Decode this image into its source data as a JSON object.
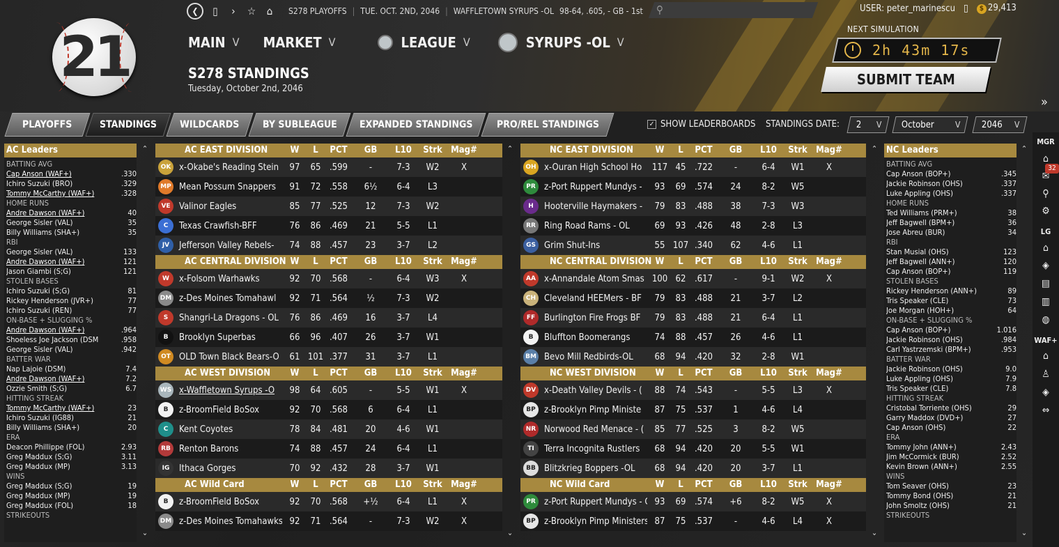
{
  "header": {
    "logo_text": "21",
    "nav_info": [
      "S278 PLAYOFFS",
      "TUE. OCT. 2ND, 2046",
      "WAFFLETOWN SYRUPS -OL",
      "98-64, .605, - GB - 1st"
    ],
    "user": "USER: peter_marinescu",
    "coins": "29,413",
    "next_sim_label": "NEXT SIMULATION",
    "timer": "2h 43m 17s",
    "submit": "SUBMIT TEAM"
  },
  "menus": [
    "MAIN",
    "MARKET",
    "LEAGUE",
    "SYRUPS -OL"
  ],
  "page": {
    "title": "S278 STANDINGS",
    "subtitle": "Tuesday, October 2nd, 2046"
  },
  "tabs": [
    "PLAYOFFS",
    "STANDINGS",
    "WILDCARDS",
    "BY SUBLEAGUE",
    "EXPANDED STANDINGS",
    "PRO/REL STANDINGS"
  ],
  "controls": {
    "show_leaderboards": "SHOW LEADERBOARDS",
    "standings_date": "STANDINGS DATE:",
    "day": "2",
    "month": "October",
    "year": "2046"
  },
  "columns": [
    "W",
    "L",
    "PCT",
    "GB",
    "L10",
    "Strk",
    "Mag#"
  ],
  "ac_leaders": {
    "title": "AC Leaders",
    "cats": [
      {
        "name": "BATTING AVG",
        "rows": [
          [
            "Cap Anson (WAF+)",
            ".330",
            true
          ],
          [
            "Ichiro Suzuki (BRO)",
            ".329",
            false
          ],
          [
            "Tommy McCarthy (WAF+)",
            ".328",
            true
          ]
        ]
      },
      {
        "name": "HOME RUNS",
        "rows": [
          [
            "Andre Dawson (WAF+)",
            "40",
            true
          ],
          [
            "George Sisler (VAL)",
            "35",
            false
          ],
          [
            "Billy Williams (SHA+)",
            "35",
            false
          ]
        ]
      },
      {
        "name": "RBI",
        "rows": [
          [
            "George Sisler (VAL)",
            "133",
            false
          ],
          [
            "Andre Dawson (WAF+)",
            "121",
            true
          ],
          [
            "Jason Giambi (S;G)",
            "121",
            false
          ]
        ]
      },
      {
        "name": "STOLEN BASES",
        "rows": [
          [
            "Ichiro Suzuki (S;G)",
            "81",
            false
          ],
          [
            "Rickey Henderson (JVR+)",
            "77",
            false
          ],
          [
            "Ichiro Suzuki (REN)",
            "77",
            false
          ]
        ]
      },
      {
        "name": "ON-BASE + SLUGGING %",
        "rows": [
          [
            "Andre Dawson (WAF+)",
            ".964",
            true
          ],
          [
            "Shoeless Joe Jackson (DSM",
            ".958",
            false
          ],
          [
            "George Sisler (VAL)",
            ".942",
            false
          ]
        ]
      },
      {
        "name": "BATTER WAR",
        "rows": [
          [
            "Nap Lajoie (DSM)",
            "7.4",
            false
          ],
          [
            "Andre Dawson (WAF+)",
            "7.2",
            true
          ],
          [
            "Ozzie Smith (S;G)",
            "6.7",
            false
          ]
        ]
      },
      {
        "name": "HITTING STREAK",
        "rows": [
          [
            "Tommy McCarthy (WAF+)",
            "23",
            true
          ],
          [
            "Ichiro Suzuki (IG88)",
            "21",
            false
          ],
          [
            "Billy Williams (SHA+)",
            "20",
            false
          ]
        ]
      },
      {
        "name": "ERA",
        "rows": [
          [
            "Deacon Phillippe (FOL)",
            "2.93",
            false
          ],
          [
            "Greg Maddux (S;G)",
            "3.11",
            false
          ],
          [
            "Greg Maddux (MP)",
            "3.13",
            false
          ]
        ]
      },
      {
        "name": "WINS",
        "rows": [
          [
            "Greg Maddux (S;G)",
            "19",
            false
          ],
          [
            "Greg Maddux (MP)",
            "19",
            false
          ],
          [
            "Greg Maddux (FOL)",
            "18",
            false
          ]
        ]
      },
      {
        "name": "STRIKEOUTS",
        "rows": []
      }
    ]
  },
  "nc_leaders": {
    "title": "NC Leaders",
    "cats": [
      {
        "name": "BATTING AVG",
        "rows": [
          [
            "Cap Anson (BOP+)",
            ".345",
            false
          ],
          [
            "Jackie Robinson (OHS)",
            ".337",
            false
          ],
          [
            "Luke Appling (OHS)",
            ".337",
            false
          ]
        ]
      },
      {
        "name": "HOME RUNS",
        "rows": [
          [
            "Ted Williams (PRM+)",
            "38",
            false
          ],
          [
            "Jeff Bagwell (BPM+)",
            "36",
            false
          ],
          [
            "Jose Abreu (BUR)",
            "34",
            false
          ]
        ]
      },
      {
        "name": "RBI",
        "rows": [
          [
            "Stan Musial (OHS)",
            "123",
            false
          ],
          [
            "Jeff Bagwell (ANN+)",
            "120",
            false
          ],
          [
            "Cap Anson (BOP+)",
            "119",
            false
          ]
        ]
      },
      {
        "name": "STOLEN BASES",
        "rows": [
          [
            "Rickey Henderson (ANN+)",
            "89",
            false
          ],
          [
            "Tris Speaker (CLE)",
            "73",
            false
          ],
          [
            "Joe Morgan (HOH+)",
            "64",
            false
          ]
        ]
      },
      {
        "name": "ON-BASE + SLUGGING %",
        "rows": [
          [
            "Cap Anson (BOP+)",
            "1.016",
            false
          ],
          [
            "Jackie Robinson (OHS)",
            ".984",
            false
          ],
          [
            "Carl Yastrzemski (BPM+)",
            ".953",
            false
          ]
        ]
      },
      {
        "name": "BATTER WAR",
        "rows": [
          [
            "Jackie Robinson (OHS)",
            "9.0",
            false
          ],
          [
            "Luke Appling (OHS)",
            "7.9",
            false
          ],
          [
            "Tris Speaker (CLE)",
            "7.8",
            false
          ]
        ]
      },
      {
        "name": "HITTING STREAK",
        "rows": [
          [
            "Cristobal Torriente (OHS)",
            "29",
            false
          ],
          [
            "Garry Maddox (DVD+)",
            "27",
            false
          ],
          [
            "Cap Anson (OHS)",
            "22",
            false
          ]
        ]
      },
      {
        "name": "ERA",
        "rows": [
          [
            "Tommy John (ANN+)",
            "2.43",
            false
          ],
          [
            "Jim McCormick (BUR)",
            "2.52",
            false
          ],
          [
            "Kevin Brown (ANN+)",
            "2.55",
            false
          ]
        ]
      },
      {
        "name": "WINS",
        "rows": [
          [
            "Tom Seaver (OHS)",
            "23",
            false
          ],
          [
            "Tommy Bond (OHS)",
            "21",
            false
          ],
          [
            "John Smoltz (OHS)",
            "21",
            false
          ]
        ]
      },
      {
        "name": "STRIKEOUTS",
        "rows": []
      }
    ]
  },
  "ac_divisions": [
    {
      "name": "AC EAST DIVISION",
      "teams": [
        {
          "name": "x-Okabe's Reading Stein",
          "w": "97",
          "l": "65",
          "pct": ".599",
          "gb": "-",
          "l10": "7-3",
          "strk": "W2",
          "mag": "X",
          "logo": "#c9a23a",
          "abbr": "OK"
        },
        {
          "name": "Mean Possum Snappers",
          "w": "91",
          "l": "72",
          "pct": ".558",
          "gb": "6½",
          "l10": "6-4",
          "strk": "L3",
          "mag": "",
          "logo": "#e07a2a",
          "abbr": "MP"
        },
        {
          "name": "Valinor Eagles",
          "w": "85",
          "l": "77",
          "pct": ".525",
          "gb": "12",
          "l10": "7-3",
          "strk": "W2",
          "mag": "",
          "logo": "#c0392b",
          "abbr": "VE"
        },
        {
          "name": "Texas Crawfish-BFF",
          "w": "76",
          "l": "86",
          "pct": ".469",
          "gb": "21",
          "l10": "5-5",
          "strk": "L1",
          "mag": "",
          "logo": "#3b6fd4",
          "abbr": "C"
        },
        {
          "name": "Jefferson Valley Rebels-",
          "w": "74",
          "l": "88",
          "pct": ".457",
          "gb": "23",
          "l10": "3-7",
          "strk": "L2",
          "mag": "",
          "logo": "#2f5fa8",
          "abbr": "JV"
        }
      ]
    },
    {
      "name": "AC CENTRAL DIVISION",
      "teams": [
        {
          "name": "x-Folsom Warhawks",
          "w": "92",
          "l": "70",
          "pct": ".568",
          "gb": "-",
          "l10": "6-4",
          "strk": "W3",
          "mag": "X",
          "logo": "#c0392b",
          "abbr": "W"
        },
        {
          "name": "z-Des Moines Tomahawl",
          "w": "92",
          "l": "71",
          "pct": ".564",
          "gb": "½",
          "l10": "7-3",
          "strk": "W2",
          "mag": "",
          "logo": "#8a8a8a",
          "abbr": "DM"
        },
        {
          "name": "Shangri-La Dragons - OL",
          "w": "76",
          "l": "86",
          "pct": ".469",
          "gb": "16",
          "l10": "3-7",
          "strk": "L4",
          "mag": "",
          "logo": "#c0392b",
          "abbr": "S"
        },
        {
          "name": "Brooklyn Superbas",
          "w": "66",
          "l": "96",
          "pct": ".407",
          "gb": "26",
          "l10": "3-7",
          "strk": "W1",
          "mag": "",
          "logo": "#111111",
          "abbr": "B"
        },
        {
          "name": "OLD Town Black Bears-O",
          "w": "61",
          "l": "101",
          "pct": ".377",
          "gb": "31",
          "l10": "3-7",
          "strk": "L1",
          "mag": "",
          "logo": "#d08a22",
          "abbr": "OT"
        }
      ]
    },
    {
      "name": "AC WEST DIVISION",
      "teams": [
        {
          "name": "x-Waffletown Syrups -O",
          "w": "98",
          "l": "64",
          "pct": ".605",
          "gb": "-",
          "l10": "5-5",
          "strk": "W1",
          "mag": "X",
          "logo": "#a9b6bc",
          "abbr": "WS",
          "u": true
        },
        {
          "name": "z-BroomField BoSox",
          "w": "92",
          "l": "70",
          "pct": ".568",
          "gb": "6",
          "l10": "6-4",
          "strk": "L1",
          "mag": "",
          "logo": "#f2f2f2",
          "abbr": "B"
        },
        {
          "name": "Kent Coyotes",
          "w": "78",
          "l": "84",
          "pct": ".481",
          "gb": "20",
          "l10": "4-6",
          "strk": "W1",
          "mag": "",
          "logo": "#1f8f8a",
          "abbr": "C"
        },
        {
          "name": "Renton Barons",
          "w": "74",
          "l": "88",
          "pct": ".457",
          "gb": "24",
          "l10": "6-4",
          "strk": "L1",
          "mag": "",
          "logo": "#b33a3a",
          "abbr": "RB"
        },
        {
          "name": "Ithaca Gorges",
          "w": "70",
          "l": "92",
          "pct": ".432",
          "gb": "28",
          "l10": "3-7",
          "strk": "W1",
          "mag": "",
          "logo": "#333333",
          "abbr": "IG"
        }
      ]
    },
    {
      "name": "AC  Wild Card",
      "teams": [
        {
          "name": "z-BroomField BoSox",
          "w": "92",
          "l": "70",
          "pct": ".568",
          "gb": "+½",
          "l10": "6-4",
          "strk": "L1",
          "mag": "X",
          "logo": "#f2f2f2",
          "abbr": "B"
        },
        {
          "name": "z-Des Moines Tomahawks",
          "w": "92",
          "l": "71",
          "pct": ".564",
          "gb": "-",
          "l10": "7-3",
          "strk": "W2",
          "mag": "X",
          "logo": "#8a8a8a",
          "abbr": "DM"
        }
      ]
    }
  ],
  "nc_divisions": [
    {
      "name": "NC EAST DIVISION",
      "teams": [
        {
          "name": "x-Ouran High School Ho",
          "w": "117",
          "l": "45",
          "pct": ".722",
          "gb": "-",
          "l10": "6-4",
          "strk": "W1",
          "mag": "X",
          "logo": "#d9a521",
          "abbr": "OH"
        },
        {
          "name": "z-Port Ruppert Mundys -",
          "w": "93",
          "l": "69",
          "pct": ".574",
          "gb": "24",
          "l10": "8-2",
          "strk": "W5",
          "mag": "",
          "logo": "#2e8b3c",
          "abbr": "PR"
        },
        {
          "name": "Hooterville Haymakers -",
          "w": "79",
          "l": "83",
          "pct": ".488",
          "gb": "38",
          "l10": "7-3",
          "strk": "W3",
          "mag": "",
          "logo": "#6a2b8c",
          "abbr": "H"
        },
        {
          "name": "Ring Road Rams - OL",
          "w": "69",
          "l": "93",
          "pct": ".426",
          "gb": "48",
          "l10": "2-8",
          "strk": "L3",
          "mag": "",
          "logo": "#777777",
          "abbr": "RR"
        },
        {
          "name": "Grim Shut-Ins",
          "w": "55",
          "l": "107",
          "pct": ".340",
          "gb": "62",
          "l10": "4-6",
          "strk": "L1",
          "mag": "",
          "logo": "#3b5fa0",
          "abbr": "GS"
        }
      ]
    },
    {
      "name": "NC CENTRAL DIVISION",
      "teams": [
        {
          "name": "x-Annandale Atom Smas",
          "w": "100",
          "l": "62",
          "pct": ".617",
          "gb": "-",
          "l10": "9-1",
          "strk": "W2",
          "mag": "X",
          "logo": "#c0392b",
          "abbr": "AA"
        },
        {
          "name": "Cleveland HEEMers - BF",
          "w": "79",
          "l": "83",
          "pct": ".488",
          "gb": "21",
          "l10": "3-7",
          "strk": "L2",
          "mag": "",
          "logo": "#c9b27a",
          "abbr": "CH"
        },
        {
          "name": "Burlington Fire Frogs BF",
          "w": "79",
          "l": "83",
          "pct": ".488",
          "gb": "21",
          "l10": "6-4",
          "strk": "L1",
          "mag": "",
          "logo": "#b02a2a",
          "abbr": "FF"
        },
        {
          "name": "Bluffton Boomerangs",
          "w": "74",
          "l": "88",
          "pct": ".457",
          "gb": "26",
          "l10": "4-6",
          "strk": "L1",
          "mag": "",
          "logo": "#f2f2f2",
          "abbr": "B"
        },
        {
          "name": "Bevo Mill Redbirds-OL",
          "w": "68",
          "l": "94",
          "pct": ".420",
          "gb": "32",
          "l10": "2-8",
          "strk": "W1",
          "mag": "",
          "logo": "#5a7fa8",
          "abbr": "BM"
        }
      ]
    },
    {
      "name": "NC WEST DIVISION",
      "teams": [
        {
          "name": "x-Death Valley Devils - (",
          "w": "88",
          "l": "74",
          "pct": ".543",
          "gb": "-",
          "l10": "5-5",
          "strk": "L3",
          "mag": "X",
          "logo": "#c0392b",
          "abbr": "DV"
        },
        {
          "name": "z-Brooklyn Pimp Ministe",
          "w": "87",
          "l": "75",
          "pct": ".537",
          "gb": "1",
          "l10": "4-6",
          "strk": "L4",
          "mag": "",
          "logo": "#e6e6e6",
          "abbr": "BP"
        },
        {
          "name": "Norwood Red Menace - (",
          "w": "85",
          "l": "77",
          "pct": ".525",
          "gb": "3",
          "l10": "8-2",
          "strk": "W5",
          "mag": "",
          "logo": "#b02a2a",
          "abbr": "NR"
        },
        {
          "name": "Terra Incognita Rustlers",
          "w": "68",
          "l": "94",
          "pct": ".420",
          "gb": "20",
          "l10": "5-5",
          "strk": "W1",
          "mag": "",
          "logo": "#444444",
          "abbr": "TI"
        },
        {
          "name": "Blitzkrieg Boppers -OL",
          "w": "68",
          "l": "94",
          "pct": ".420",
          "gb": "20",
          "l10": "3-7",
          "strk": "L1",
          "mag": "",
          "logo": "#dddddd",
          "abbr": "BB"
        }
      ]
    },
    {
      "name": "NC  Wild Card",
      "teams": [
        {
          "name": "z-Port Ruppert Mundys - OL",
          "w": "93",
          "l": "69",
          "pct": ".574",
          "gb": "+6",
          "l10": "8-2",
          "strk": "W5",
          "mag": "X",
          "logo": "#2e8b3c",
          "abbr": "PR"
        },
        {
          "name": "z-Brooklyn Pimp Ministers -",
          "w": "87",
          "l": "75",
          "pct": ".537",
          "gb": "-",
          "l10": "4-6",
          "strk": "L4",
          "mag": "X",
          "logo": "#e6e6e6",
          "abbr": "BP"
        }
      ]
    }
  ],
  "right_sidebar": {
    "mgr": "MGR",
    "lg": "LG",
    "waf": "WAF+",
    "badge": "32"
  }
}
